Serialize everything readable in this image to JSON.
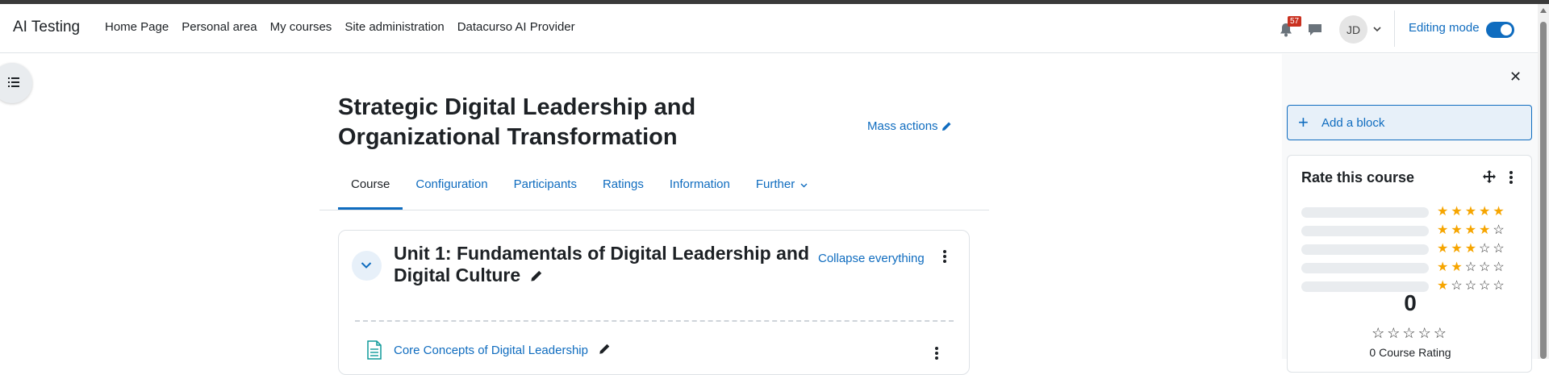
{
  "app": {
    "title": "AI Testing"
  },
  "nav": {
    "items": [
      "Home Page",
      "Personal area",
      "My courses",
      "Site administration",
      "Datacurso AI Provider"
    ]
  },
  "header": {
    "notifications_count": "57",
    "user_initials": "JD",
    "editing_mode_label": "Editing mode",
    "editing_mode_on": true
  },
  "course": {
    "title": "Strategic Digital Leadership and Organizational Transformation",
    "mass_actions_label": "Mass actions"
  },
  "tabs": [
    {
      "label": "Course",
      "active": true
    },
    {
      "label": "Configuration"
    },
    {
      "label": "Participants"
    },
    {
      "label": "Ratings"
    },
    {
      "label": "Information"
    },
    {
      "label": "Further"
    }
  ],
  "section": {
    "title": "Unit 1: Fundamentals of Digital Leadership and Digital Culture",
    "collapse_all_label": "Collapse everything",
    "activities": [
      {
        "name": "Core Concepts of Digital Leadership",
        "icon": "page-icon"
      }
    ]
  },
  "blocks": {
    "add_block_label": "Add a block",
    "rate_course": {
      "title": "Rate this course",
      "rows": [
        {
          "stars": 5,
          "count_fraction": 0
        },
        {
          "stars": 4,
          "count_fraction": 0
        },
        {
          "stars": 3,
          "count_fraction": 0
        },
        {
          "stars": 2,
          "count_fraction": 0
        },
        {
          "stars": 1,
          "count_fraction": 0
        }
      ],
      "average": "0",
      "summary": "0 Course Rating"
    }
  },
  "colors": {
    "accent": "#0f6cbf",
    "star": "#f6a500",
    "badge": "#ca3120"
  }
}
